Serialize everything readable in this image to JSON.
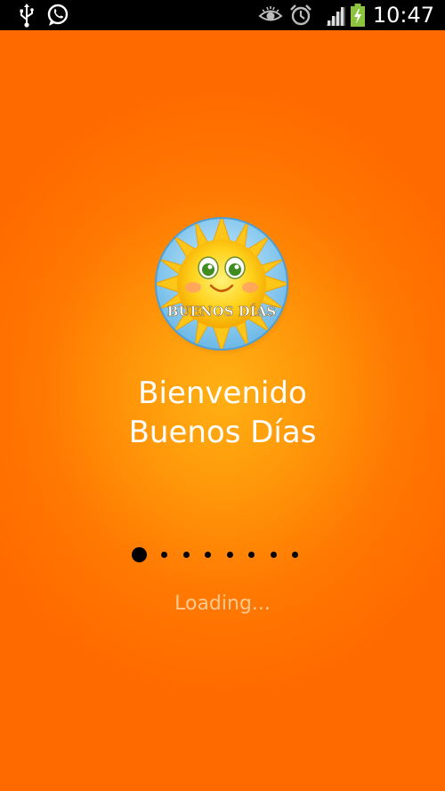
{
  "status_bar": {
    "time": "10:47",
    "icons": [
      "usb-icon",
      "whatsapp-icon",
      "eye-icon",
      "alarm-icon",
      "signal-icon",
      "battery-charging-icon"
    ]
  },
  "splash": {
    "logo_icon": "sun-logo-icon",
    "logo_text": "BUENOS DÍAS",
    "title_line1": "Bienvenido",
    "title_line2": "Buenos Días",
    "loading_text": "Loading...",
    "progress": {
      "total_dots": 8,
      "active_index": 0
    }
  },
  "colors": {
    "background_outer": "#ff6a00",
    "background_center": "#ffb014",
    "text": "#ffffff",
    "loading_text": "#ffc98f",
    "dots": "#000000"
  }
}
